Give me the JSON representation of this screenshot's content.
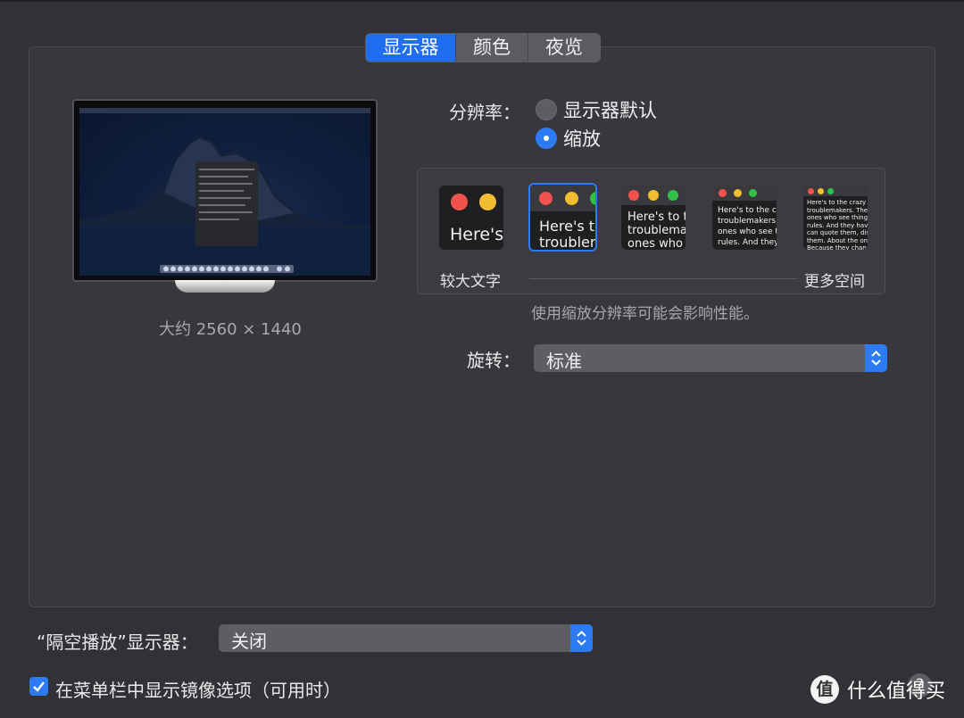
{
  "tabs": [
    {
      "label": "显示器",
      "active": true
    },
    {
      "label": "颜色",
      "active": false
    },
    {
      "label": "夜览",
      "active": false
    }
  ],
  "display": {
    "size_label": "大约 2560 × 1440"
  },
  "resolution": {
    "label": "分辨率：",
    "options": [
      {
        "label": "显示器默认",
        "selected": false
      },
      {
        "label": "缩放",
        "selected": true
      }
    ]
  },
  "scale": {
    "thumbnails": [
      {
        "text": "Here's",
        "selected": false
      },
      {
        "text": "Here's to\ntroublem",
        "selected": true
      },
      {
        "text": "Here's to t\ntroublema\nones who",
        "selected": false
      },
      {
        "text": "Here's to the cr\ntroublemakers.\nones who see t\nrules. And they",
        "selected": false
      },
      {
        "text": "Here's to the crazy one\ntroublemakers. The rou\nones who see things dif\nrules. And they have no\ncan quote them, disagre\nthem. About the only th\nBecause they change th",
        "selected": false
      }
    ],
    "left_label": "较大文字",
    "right_label": "更多空间",
    "hint": "使用缩放分辨率可能会影响性能。"
  },
  "rotation": {
    "label": "旋转：",
    "value": "标准"
  },
  "airplay": {
    "label": "“隔空播放”显示器：",
    "value": "关闭"
  },
  "mirror_option": {
    "label": "在菜单栏中显示镜像选项（可用时）",
    "checked": true
  },
  "help_label": "?",
  "watermark": {
    "badge": "值",
    "text": "什么值得买"
  },
  "colors": {
    "accent": "#2d7bf3",
    "window_bg": "#323236",
    "traffic_red": "#f2524d",
    "traffic_yellow": "#f0be2e",
    "traffic_green": "#30c148"
  }
}
